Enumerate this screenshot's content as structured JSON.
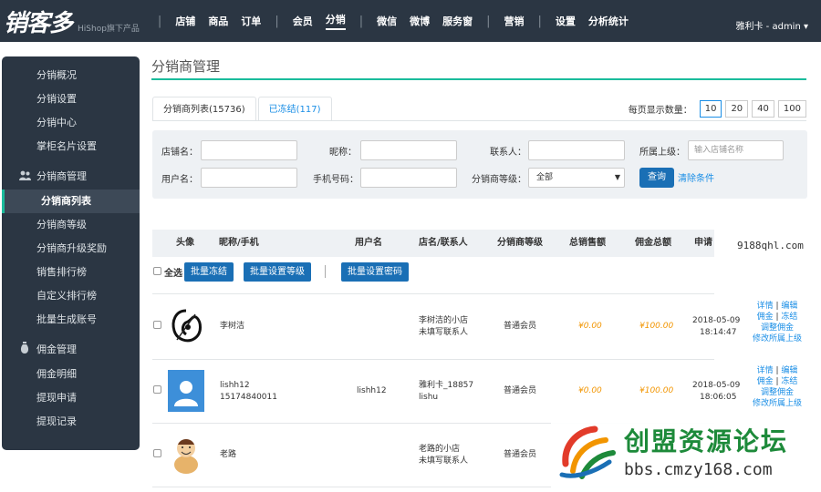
{
  "topbar": {
    "logo": "销客多",
    "logo_sub": "HiShop旗下产品",
    "nav": [
      "店铺",
      "商品",
      "订单",
      "会员",
      "分销",
      "微信",
      "微博",
      "服务窗",
      "营销",
      "设置",
      "分析统计"
    ],
    "active_nav": "分销",
    "user": "雅利卡 - admin ▾"
  },
  "sidebar": {
    "items_top": [
      "分销概况",
      "分销设置",
      "分销中心",
      "掌柜名片设置"
    ],
    "group1": "分销商管理",
    "group1_items": [
      "分销商列表",
      "分销商等级",
      "分销商升级奖励",
      "销售排行榜",
      "自定义排行榜",
      "批量生成账号"
    ],
    "group1_active": "分销商列表",
    "group2": "佣金管理",
    "group2_items": [
      "佣金明细",
      "提现申请",
      "提现记录"
    ]
  },
  "page": {
    "title": "分销商管理",
    "tabs": [
      "分销商列表(15736)",
      "已冻结(117)"
    ],
    "page_size_label": "每页显示数量：",
    "page_sizes": [
      "10",
      "20",
      "40",
      "100"
    ],
    "page_size_selected": "10"
  },
  "filter": {
    "shop_name_label": "店铺名：",
    "nickname_label": "昵称：",
    "contact_label": "联系人：",
    "superior_label": "所属上级：",
    "superior_placeholder": "输入店铺名称",
    "username_label": "用户名：",
    "phone_label": "手机号码：",
    "level_label": "分销商等级：",
    "level_value": "全部",
    "query_button": "查询",
    "clear_link": "清除条件"
  },
  "table": {
    "headers": [
      "头像",
      "昵称/手机",
      "用户名",
      "店名/联系人",
      "分销商等级",
      "总销售额",
      "佣金总额",
      "申请"
    ],
    "select_all": "全选",
    "bulk_freeze": "批量冻结",
    "bulk_set_level": "批量设置等级",
    "bulk_set_password": "批量设置密码",
    "rows": [
      {
        "nickname": "李树洁",
        "phone": "",
        "username": "",
        "shop": "李树洁的小店",
        "contact": "未填写联系人",
        "level": "普通会员",
        "sales": "¥0.00",
        "commission": "¥100.00",
        "date": "2018-05-09",
        "time": "18:14:47",
        "actions": [
          "详情",
          "编辑",
          "佣金",
          "冻结",
          "调整佣金",
          "修改所属上级"
        ]
      },
      {
        "nickname": "lishh12",
        "phone": "15174840011",
        "username": "lishh12",
        "shop": "雅利卡_18857",
        "contact": "lishu",
        "level": "普通会员",
        "sales": "¥0.00",
        "commission": "¥100.00",
        "date": "2018-05-09",
        "time": "18:06:05",
        "actions": [
          "详情",
          "编辑",
          "佣金",
          "冻结",
          "调整佣金",
          "修改所属上级"
        ]
      },
      {
        "nickname": "老路",
        "phone": "",
        "username": "",
        "shop": "老路的小店",
        "contact": "未填写联系人",
        "level": "普通会员"
      }
    ]
  },
  "watermarks": {
    "site": "9188qhl.com",
    "forum_title": "创盟资源论坛",
    "forum_url": "bbs.cmzy168.com"
  },
  "colors": {
    "topbar": "#2b3643",
    "accent": "#1abc9c",
    "button_blue": "#1a6fb5",
    "link_blue": "#1a8ee6",
    "money_orange": "#f29500"
  }
}
